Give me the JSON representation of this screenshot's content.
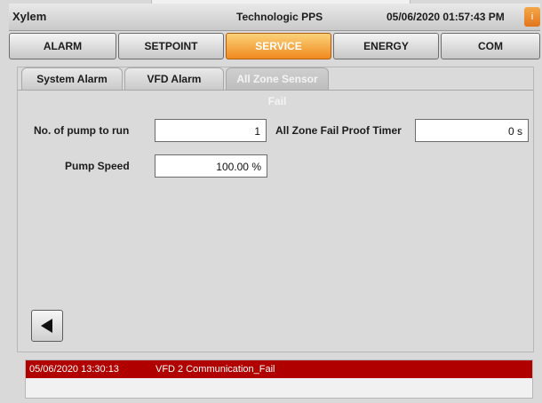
{
  "titlebar": {
    "app_name": "Xylem",
    "product": "Technologic PPS",
    "datetime": "05/06/2020 01:57:43 PM",
    "info_glyph": "i"
  },
  "main_tabs": [
    {
      "label": "ALARM",
      "active": false
    },
    {
      "label": "SETPOINT",
      "active": false
    },
    {
      "label": "SERVICE",
      "active": true
    },
    {
      "label": "ENERGY",
      "active": false
    },
    {
      "label": "COM",
      "active": false
    }
  ],
  "sub_tabs": [
    {
      "label": "System Alarm",
      "active": false
    },
    {
      "label": "VFD Alarm",
      "active": false
    },
    {
      "label": "All Zone Sensor Fail",
      "active": true
    }
  ],
  "form": {
    "pumps_to_run_label": "No. of pump to run",
    "pumps_to_run_value": "1",
    "fail_proof_timer_label": "All Zone Fail Proof Timer",
    "fail_proof_timer_value": "0 s",
    "pump_speed_label": "Pump Speed",
    "pump_speed_value": "100.00 %"
  },
  "back_button": {
    "icon": "triangle-left-icon"
  },
  "alarms": [
    {
      "timestamp": "05/06/2020 13:30:13",
      "message": "VFD 2 Communication_Fail"
    }
  ],
  "colors": {
    "active_tab": "#f08a1e",
    "alarm_row": "#b00000"
  }
}
